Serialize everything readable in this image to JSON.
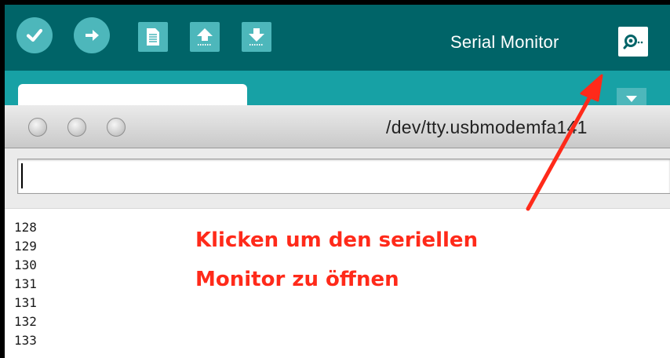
{
  "toolbar": {
    "serial_monitor_label": "Serial Monitor"
  },
  "window": {
    "title": "/dev/tty.usbmodemfa141"
  },
  "send_input": {
    "value": ""
  },
  "output_lines": [
    "128",
    "129",
    "130",
    "131",
    "131",
    "132",
    "133"
  ],
  "annotation": {
    "line1": "Klicken um den seriellen",
    "line2": "Monitor zu öffnen",
    "color": "#ff2a1a"
  },
  "colors": {
    "toolbar_bg": "#006468",
    "tabstrip_bg": "#17a1a5",
    "button_bg": "#4db7bb"
  },
  "icons": [
    "verify-icon",
    "upload-icon",
    "new-file-icon",
    "open-icon",
    "save-icon",
    "serial-monitor-icon",
    "tab-menu-icon"
  ]
}
